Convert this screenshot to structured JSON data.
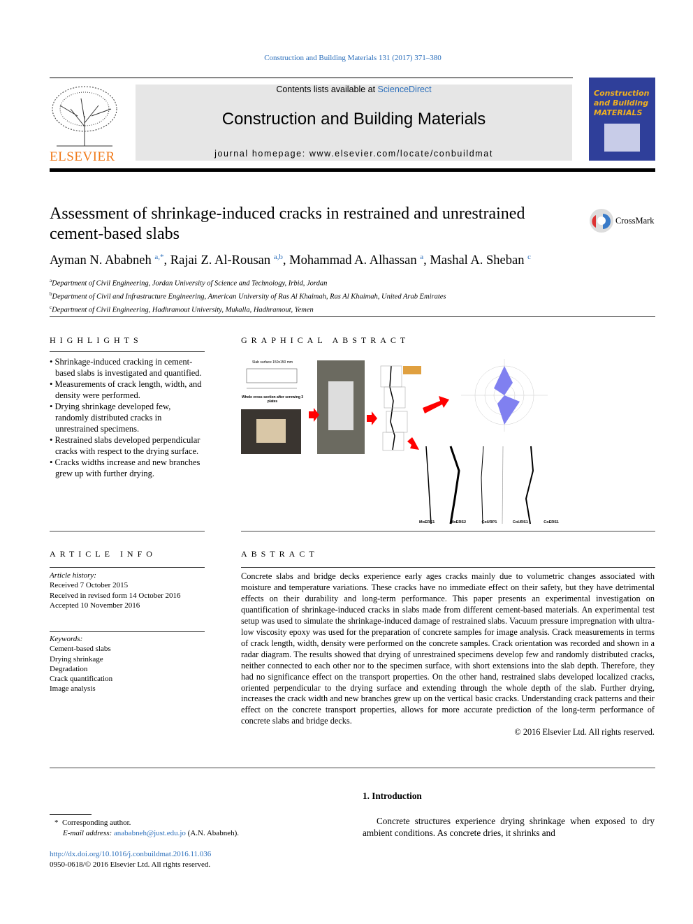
{
  "citation": "Construction and Building Materials 131 (2017) 371–380",
  "header": {
    "contents_prefix": "Contents lists available at ",
    "contents_link": "ScienceDirect",
    "journal_title": "Construction and Building Materials",
    "homepage": "journal homepage: www.elsevier.com/locate/conbuildmat",
    "publisher_logo": "ELSEVIER",
    "cover_title": "Construction and Building MATERIALS"
  },
  "article": {
    "title": "Assessment of shrinkage-induced cracks in restrained and unrestrained cement-based slabs",
    "crossmark": "CrossMark",
    "authors": [
      {
        "name": "Ayman N. Ababneh",
        "sup": "a,*"
      },
      {
        "name": "Rajai Z. Al-Rousan",
        "sup": "a,b"
      },
      {
        "name": "Mohammad A. Alhassan",
        "sup": "a"
      },
      {
        "name": "Mashal A. Sheban",
        "sup": "c"
      }
    ],
    "affiliations": [
      {
        "mark": "a",
        "text": "Department of Civil Engineering, Jordan University of Science and Technology, Irbid, Jordan"
      },
      {
        "mark": "b",
        "text": "Department of Civil and Infrastructure Engineering, American University of Ras Al Khaimah, Ras Al Khaimah, United Arab Emirates"
      },
      {
        "mark": "c",
        "text": "Department of Civil Engineering, Hadhramout University, Mukalla, Hadhramout, Yemen"
      }
    ]
  },
  "highlights": {
    "heading": "HIGHLIGHTS",
    "items": [
      "Shrinkage-induced cracking in cement-based slabs is investigated and quantified.",
      "Measurements of crack length, width, and density were performed.",
      "Drying shrinkage developed few, randomly distributed cracks in unrestrained specimens.",
      "Restrained slabs developed perpendicular cracks with respect to the drying surface.",
      "Cracks widths increase and new branches grew up with further drying."
    ]
  },
  "graphical_abstract": {
    "heading": "GRAPHICAL ABSTRACT",
    "figure_labels": {
      "slab": "Slab surface 150x150 mm",
      "section": "Whole cross section after screwing 3 plates",
      "cracks": [
        "MoERS1",
        "MoERS2",
        "CoURP1",
        "CoURS1",
        "CoERS1"
      ]
    }
  },
  "article_info": {
    "heading": "ARTICLE INFO",
    "history_label": "Article history:",
    "history": [
      "Received 7 October 2015",
      "Received in revised form 14 October 2016",
      "Accepted 10 November 2016"
    ],
    "keywords_label": "Keywords:",
    "keywords": [
      "Cement-based slabs",
      "Drying shrinkage",
      "Degradation",
      "Crack quantification",
      "Image analysis"
    ]
  },
  "abstract": {
    "heading": "ABSTRACT",
    "text": "Concrete slabs and bridge decks experience early ages cracks mainly due to volumetric changes associated with moisture and temperature variations. These cracks have no immediate effect on their safety, but they have detrimental effects on their durability and long-term performance. This paper presents an experimental investigation on quantification of shrinkage-induced cracks in slabs made from different cement-based materials. An experimental test setup was used to simulate the shrinkage-induced damage of restrained slabs. Vacuum pressure impregnation with ultra-low viscosity epoxy was used for the preparation of concrete samples for image analysis. Crack measurements in terms of crack length, width, density were performed on the concrete samples. Crack orientation was recorded and shown in a radar diagram. The results showed that drying of unrestrained specimens develop few and randomly distributed cracks, neither connected to each other nor to the specimen surface, with short extensions into the slab depth. Therefore, they had no significance effect on the transport properties. On the other hand, restrained slabs developed localized cracks, oriented perpendicular to the drying surface and extending through the whole depth of the slab. Further drying, increases the crack width and new branches grew up on the vertical basic cracks. Understanding crack patterns and their effect on the concrete transport properties, allows for more accurate prediction of the long-term performance of concrete slabs and bridge decks.",
    "copyright": "© 2016 Elsevier Ltd. All rights reserved."
  },
  "introduction": {
    "heading": "1. Introduction",
    "text": "Concrete structures experience drying shrinkage when exposed to dry ambient conditions. As concrete dries, it shrinks and"
  },
  "footnote": {
    "mark": "*",
    "corresponding": "Corresponding author.",
    "email_label": "E-mail address: ",
    "email": "anababneh@just.edu.jo",
    "email_suffix": " (A.N. Ababneh).",
    "doi": "http://dx.doi.org/10.1016/j.conbuildmat.2016.11.036",
    "issn": "0950-0618/© 2016 Elsevier Ltd. All rights reserved."
  },
  "colors": {
    "link": "#2a6ebb",
    "banner": "#e6e6e6",
    "publisher": "#f07a1a",
    "arrow": "#ff0000",
    "radar": "#8080f0"
  }
}
